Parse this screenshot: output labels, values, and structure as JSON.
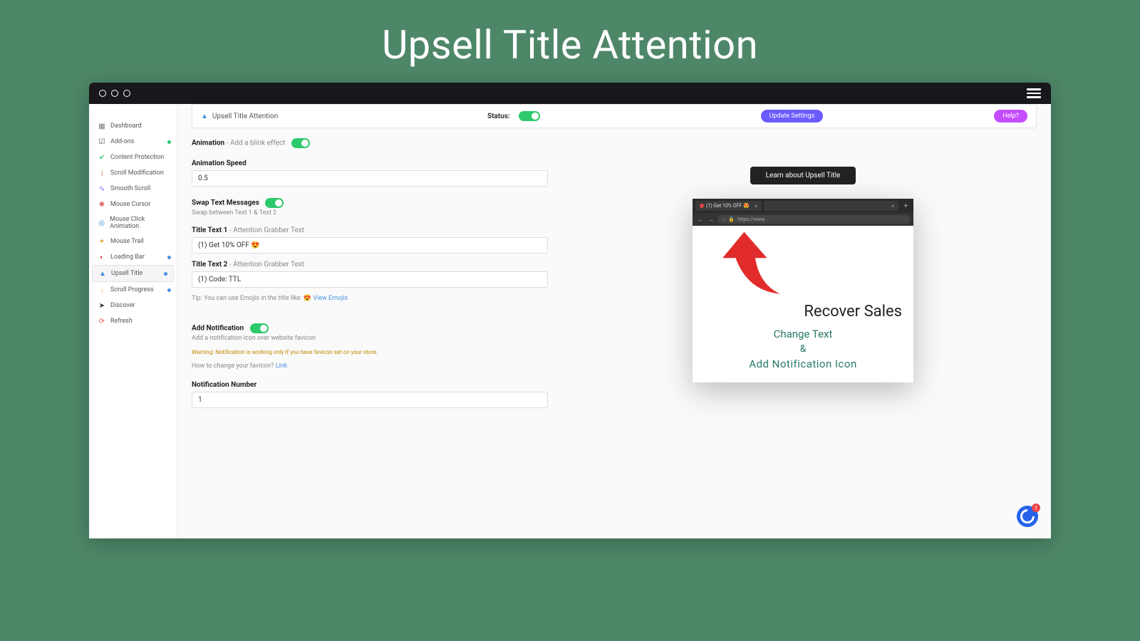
{
  "hero": "Upsell Title Attention",
  "sidebar": {
    "items": [
      {
        "icon": "▦",
        "color": "#7a7a7a",
        "label": "Dashboard",
        "dot": null
      },
      {
        "icon": "☑",
        "color": "#555",
        "label": "Add-ons",
        "dot": "green"
      },
      {
        "icon": "✔",
        "color": "#2dc96b",
        "label": "Content Protection",
        "dot": null
      },
      {
        "icon": "↕",
        "color": "#e8554a",
        "label": "Scroll Modification",
        "dot": null
      },
      {
        "icon": "∿",
        "color": "#6a5cff",
        "label": "Smooth Scroll",
        "dot": null
      },
      {
        "icon": "✱",
        "color": "#d66",
        "label": "Mouse Cursor",
        "dot": null
      },
      {
        "icon": "◎",
        "color": "#4a90e2",
        "label": "Mouse Click Animation",
        "dot": null
      },
      {
        "icon": "✦",
        "color": "#e8a23a",
        "label": "Mouse Trail",
        "dot": null
      },
      {
        "icon": "◐",
        "color": "#e8554a",
        "label": "Loading Bar",
        "dot": "blue"
      },
      {
        "icon": "▲",
        "color": "#4a90e2",
        "label": "Upsell Title",
        "dot": "blue",
        "active": true
      },
      {
        "icon": "↓",
        "color": "#e8a23a",
        "label": "Scroll Progress",
        "dot": "blue"
      },
      {
        "icon": "➤",
        "color": "#333",
        "label": "Discover",
        "dot": null
      },
      {
        "icon": "⟳",
        "color": "#e8554a",
        "label": "Refresh",
        "dot": null
      }
    ]
  },
  "topbar": {
    "icon": "▲",
    "title": "Upsell Title Attention",
    "status_label": "Status:",
    "update": "Update Settings",
    "help": "Help?"
  },
  "form": {
    "animation_label": "Animation",
    "animation_sub": " - Add a blink effect",
    "speed_label": "Animation Speed",
    "speed_value": "0.5",
    "swap_label": "Swap Text Messages",
    "swap_desc": "Swap between Text 1 & Text 2",
    "title1_label": "Title Text 1",
    "title1_sub": " - Attention Grabber Text",
    "title1_value": "(1) Get 10% OFF 😍",
    "title2_label": "Title Text 2",
    "title2_sub": " - Attention Grabber Text",
    "title2_value": "(1) Code: TTL",
    "tip_prefix": "Tip: You can use Emojis in the title like: 😍 ",
    "tip_link": "View Emojis",
    "notif_label": "Add Notification",
    "notif_desc": "Add a notification icon over website favicon",
    "warn": "Warning: Notification is working only if you have favicon set on your store.",
    "favicon_q": "How to change your favicon? ",
    "favicon_link": "Link",
    "notif_num_label": "Notification Number",
    "notif_num_value": "1"
  },
  "preview": {
    "learn": "Learn about Upsell Title",
    "tab_text": "(1) Get 10% OFF 😍",
    "addr": "https://www.",
    "recover": "Recover Sales",
    "change": "Change Text",
    "amp": "&",
    "addnotif": "Add  Notification  Icon"
  },
  "chat_badge": "1"
}
